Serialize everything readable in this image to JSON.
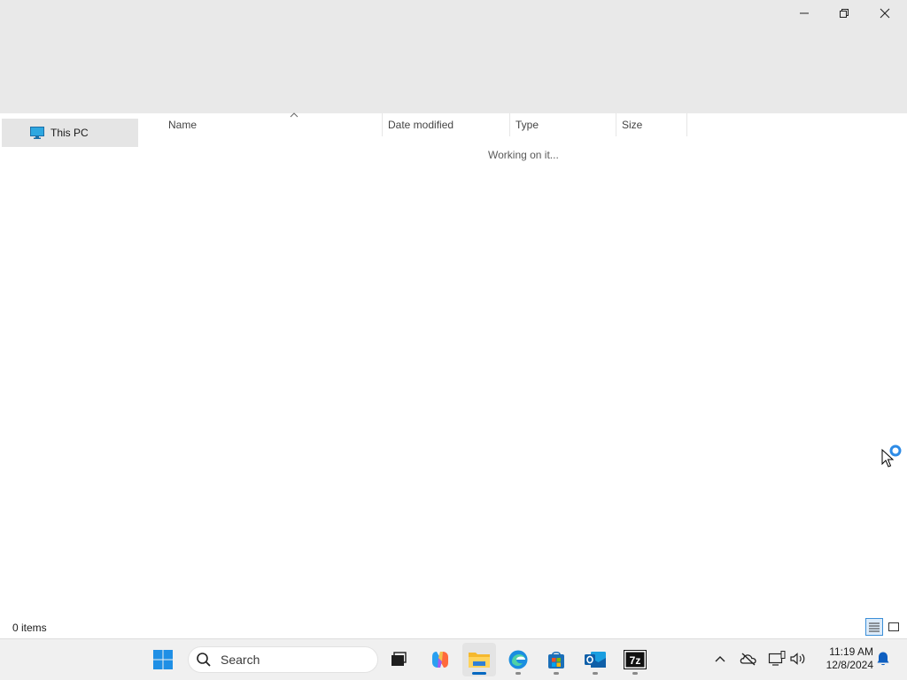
{
  "window": {
    "controls": {
      "minimize_icon": "minimize-icon",
      "restore_icon": "restore-icon",
      "close_icon": "close-icon"
    }
  },
  "nav": {
    "items": [
      {
        "label": "This PC",
        "icon": "monitor-icon"
      }
    ]
  },
  "file_list": {
    "columns": [
      "Name",
      "Date modified",
      "Type",
      "Size"
    ],
    "sort_column": "Name",
    "sort_direction": "ascending",
    "status_text": "Working on it..."
  },
  "status_bar": {
    "item_count": "0 items",
    "active_view": "details"
  },
  "taskbar": {
    "search_placeholder": "Search",
    "apps": [
      {
        "name": "Start",
        "icon": "windows-start-icon",
        "state": "none"
      },
      {
        "name": "Task View",
        "icon": "task-view-icon",
        "state": "none"
      },
      {
        "name": "Copilot",
        "icon": "copilot-icon",
        "state": "none"
      },
      {
        "name": "File Explorer",
        "icon": "folder-icon",
        "state": "active"
      },
      {
        "name": "Microsoft Edge",
        "icon": "edge-icon",
        "state": "open"
      },
      {
        "name": "Microsoft Store",
        "icon": "store-icon",
        "state": "open"
      },
      {
        "name": "Outlook",
        "icon": "outlook-icon",
        "state": "open"
      },
      {
        "name": "7-Zip",
        "icon": "7zip-icon",
        "state": "open"
      }
    ],
    "tray": {
      "icons": [
        "chevron-up-icon",
        "onedrive-offline-icon",
        "network-icon",
        "volume-icon",
        "notification-bell-icon"
      ],
      "time": "11:19 AM",
      "date": "12/8/2024"
    }
  },
  "colors": {
    "accent": "#0067c0",
    "titlebar_bg": "#e9e9e9",
    "taskbar_bg": "#f0f0f0",
    "nav_selected_bg": "#e5e5e5"
  }
}
